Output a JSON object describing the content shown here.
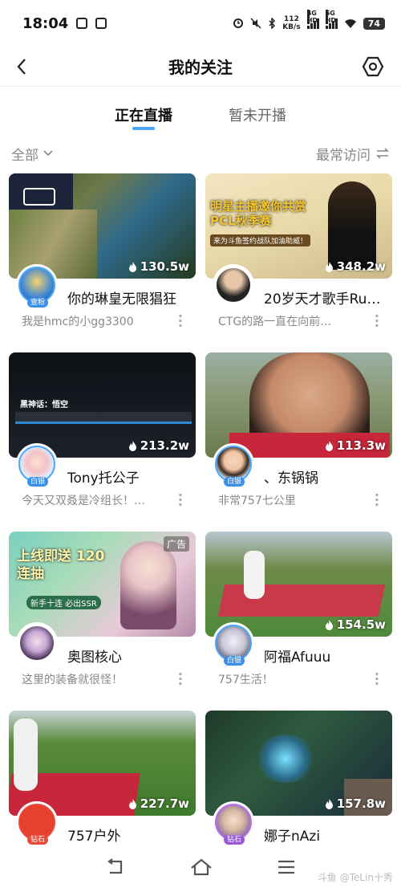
{
  "status": {
    "time": "18:04",
    "speed_value": "112",
    "speed_unit": "KB/s",
    "net1": "4G HD",
    "net2": "5G HD",
    "battery": "74"
  },
  "header": {
    "title": "我的关注"
  },
  "tabs": [
    {
      "label": "正在直播",
      "active": true
    },
    {
      "label": "暂未开播",
      "active": false
    }
  ],
  "filter": {
    "left": "全部",
    "right": "最常访问"
  },
  "cards": [
    {
      "name": "你的琳皇无限猖狂",
      "room": "我是hmc的小gg3300",
      "views": "130.5w",
      "badge": "壹粉"
    },
    {
      "name": "20岁天才歌手Ru…",
      "room": "CTG的路一直在向前…",
      "views": "348.2w",
      "badge": "",
      "thumb_text": "明星主播邀你共赏 PCL秋季赛",
      "thumb_sub": "来为斗鱼签约战队加油助威！"
    },
    {
      "name": "Tony托公子",
      "room": "今天又双叒是冷组长！…",
      "views": "213.2w",
      "badge": "白银",
      "thumb_text": "黑神话：悟空"
    },
    {
      "name": "、东锅锅",
      "room": "非常757七公里",
      "views": "113.3w",
      "badge": "白银"
    },
    {
      "name": "奥图核心",
      "room": "这里的装备就很怪！",
      "views": "",
      "badge": "",
      "ad": "广告",
      "thumb_text": "上线即送 120连抽",
      "thumb_sub": "新手十连 必出SSR"
    },
    {
      "name": "阿福Afuuu",
      "room": "757生活！",
      "views": "154.5w",
      "badge": "白银"
    },
    {
      "name": "757户外",
      "room": "",
      "views": "227.7w",
      "badge": "钻石"
    },
    {
      "name": "娜子nAzi",
      "room": "",
      "views": "157.8w",
      "badge": "钻石"
    }
  ],
  "watermark": "斗鱼 @TeLin十秀"
}
